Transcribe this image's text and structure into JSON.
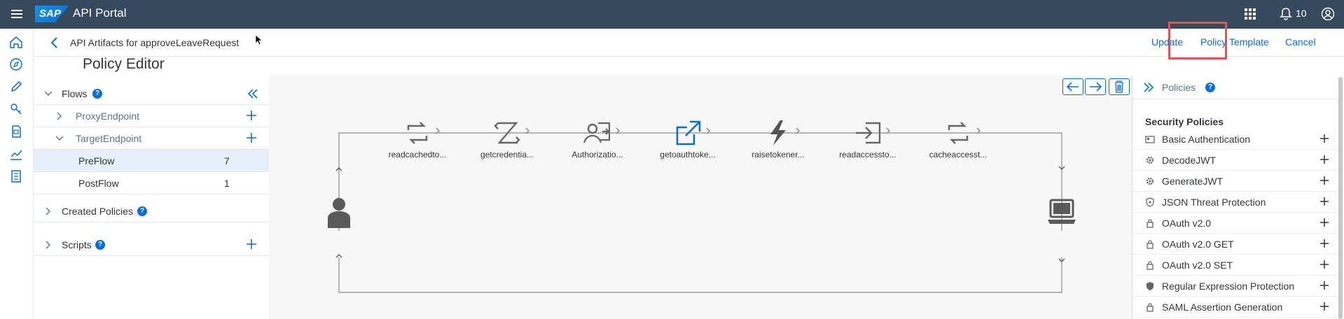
{
  "shell": {
    "app_title": "API Portal",
    "logo": "SAP",
    "notifications_count": "10"
  },
  "subheader": {
    "breadcrumb": "API Artifacts for approveLeaveRequest",
    "update_label": "Update",
    "policy_template_label": "Policy Template",
    "cancel_label": "Cancel"
  },
  "page_title": "Policy Editor",
  "flows": {
    "flows_label": "Flows",
    "proxy_endpoint": "ProxyEndpoint",
    "target_endpoint": "TargetEndpoint",
    "preflow": {
      "label": "PreFlow",
      "count": "7"
    },
    "postflow": {
      "label": "PostFlow",
      "count": "1"
    },
    "created_policies": "Created Policies",
    "scripts": "Scripts"
  },
  "steps": [
    {
      "label": "readcachedto...",
      "icon": "cycle-icon"
    },
    {
      "label": "getcredentia...",
      "icon": "transform-icon"
    },
    {
      "label": "Authorizatio...",
      "icon": "user-login-icon"
    },
    {
      "label": "getoauthtoke...",
      "icon": "external-link-icon"
    },
    {
      "label": "raisetokener...",
      "icon": "lightning-icon"
    },
    {
      "label": "readaccessto...",
      "icon": "login-arrow-icon"
    },
    {
      "label": "cacheaccesst...",
      "icon": "cycle-icon"
    }
  ],
  "policies_panel": {
    "title": "Policies",
    "section": "Security Policies",
    "items": [
      "Basic Authentication",
      "DecodeJWT",
      "GenerateJWT",
      "JSON Threat Protection",
      "OAuth v2.0",
      "OAuth v2.0 GET",
      "OAuth v2.0 SET",
      "Regular Expression Protection",
      "SAML Assertion Generation"
    ]
  },
  "colors": {
    "shell": "#354a5f",
    "accent": "#0a6ed1",
    "highlight": "#e05454"
  }
}
